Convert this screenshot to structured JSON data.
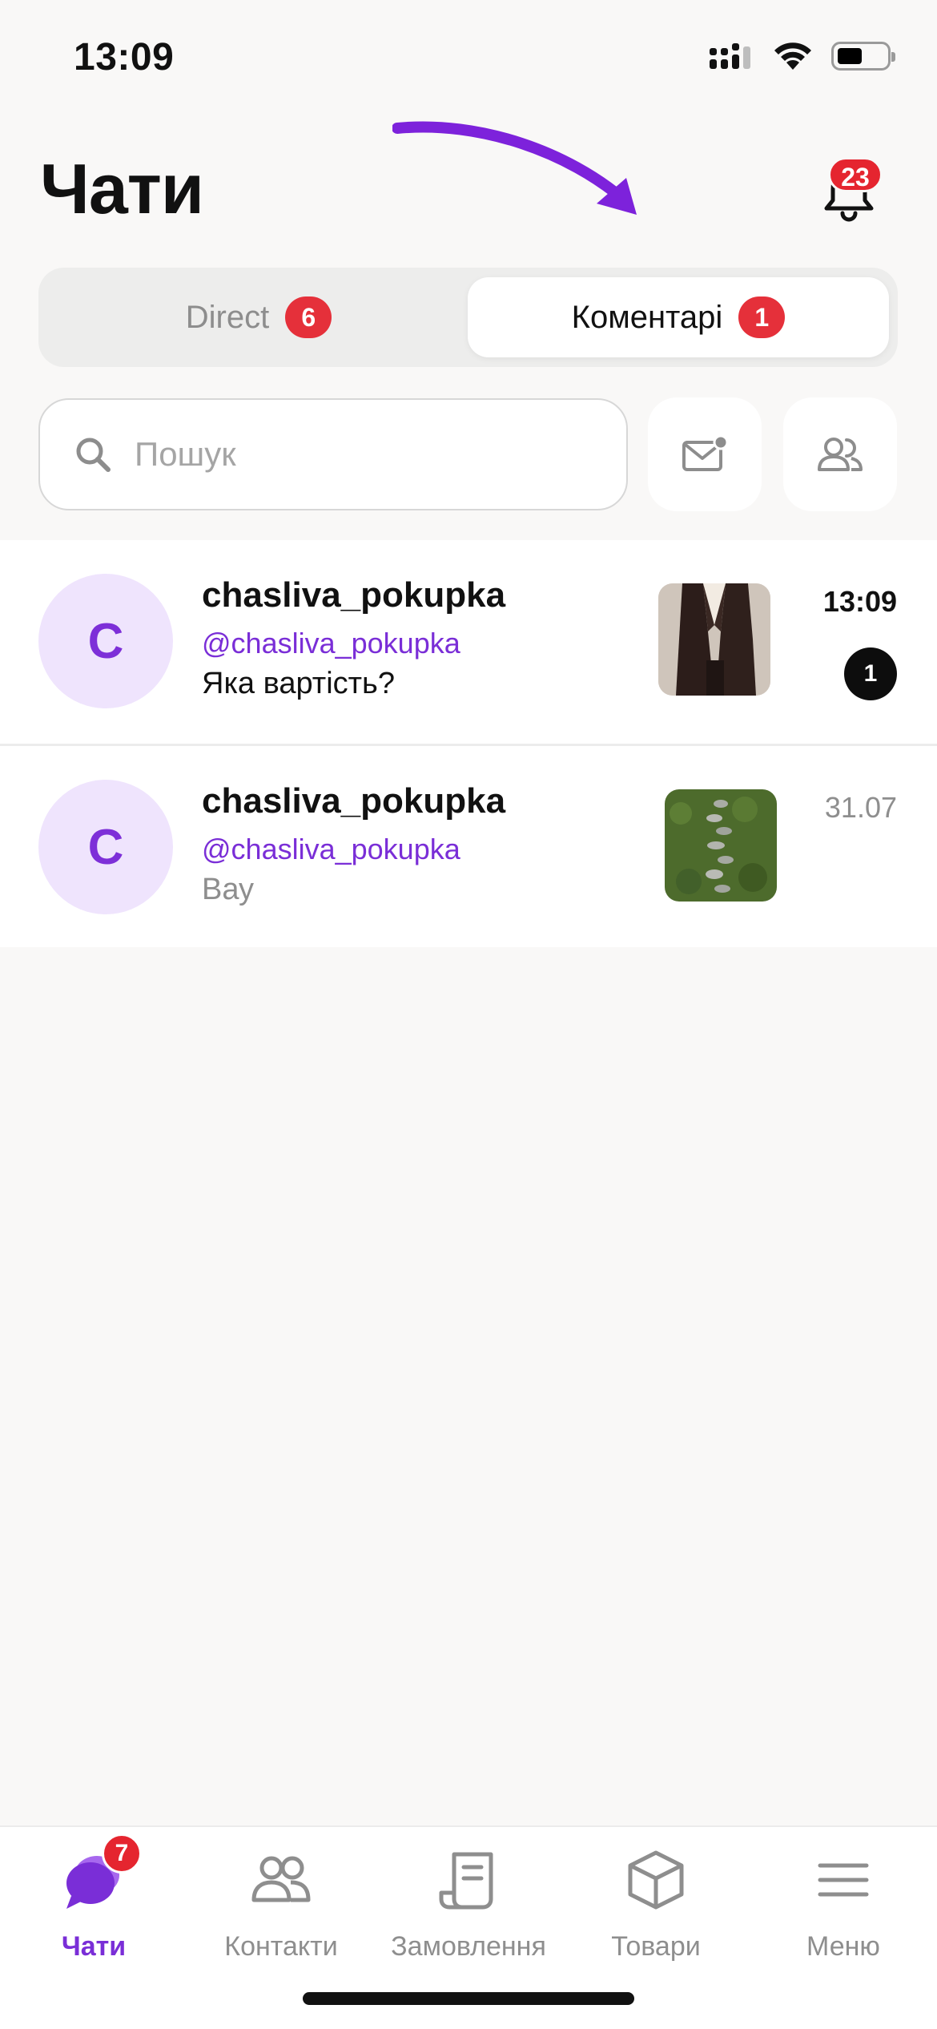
{
  "status_bar": {
    "time": "13:09"
  },
  "header": {
    "title": "Чати",
    "notifications_count": "23"
  },
  "segments": [
    {
      "label": "Direct",
      "badge": "6",
      "active": false
    },
    {
      "label": "Коментарі",
      "badge": "1",
      "active": true
    }
  ],
  "search": {
    "placeholder": "Пошук",
    "value": ""
  },
  "chats": [
    {
      "avatar_letter": "C",
      "name": "chasliva_pokupka",
      "handle": "@chasliva_pokupka",
      "message": "Яка вартість?",
      "time": "13:09",
      "unread": "1",
      "thumbnail": "brown-suit-photo"
    },
    {
      "avatar_letter": "C",
      "name": "chasliva_pokupka",
      "handle": "@chasliva_pokupka",
      "message": "Вау",
      "time": "31.07",
      "unread": "",
      "thumbnail": "grass-stones-photo"
    }
  ],
  "tabbar": {
    "items": [
      {
        "label": "Чати",
        "icon": "chat-bubbles-icon",
        "badge": "7",
        "active": true
      },
      {
        "label": "Контакти",
        "icon": "contacts-icon",
        "active": false
      },
      {
        "label": "Замовлення",
        "icon": "orders-receipt-icon",
        "active": false
      },
      {
        "label": "Товари",
        "icon": "box-icon",
        "active": false
      },
      {
        "label": "Меню",
        "icon": "hamburger-menu-icon",
        "active": false
      }
    ]
  },
  "colors": {
    "accent": "#7a2ed7",
    "badge_red": "#e5252f",
    "background": "#f9f8f7",
    "avatar_bg": "#efe4fd"
  }
}
